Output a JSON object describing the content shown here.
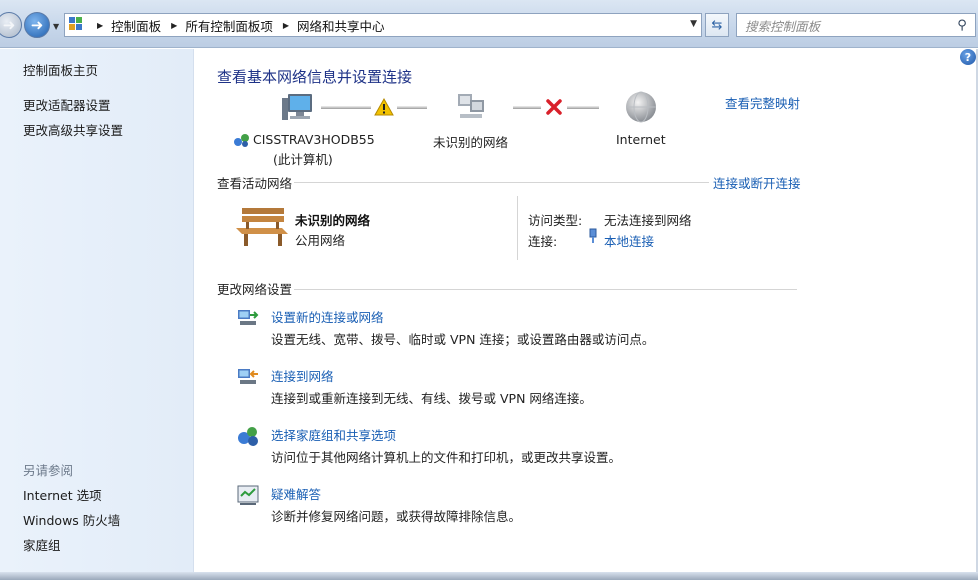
{
  "address_bar": {
    "breadcrumbs": [
      "控制面板",
      "所有控制面板项",
      "网络和共享中心"
    ],
    "search_placeholder": "搜索控制面板"
  },
  "left_pane": {
    "links": [
      "控制面板主页",
      "更改适配器设置",
      "更改高级共享设置"
    ],
    "see_also_heading": "另请参阅",
    "see_also": [
      "Internet 选项",
      "Windows 防火墙",
      "家庭组"
    ]
  },
  "main": {
    "title": "查看基本网络信息并设置连接",
    "full_map_link": "查看完整映射",
    "network_map": {
      "computer_name": "CISSTRAV3HODB55",
      "computer_sub": "(此计算机)",
      "middle_label": "未识别的网络",
      "internet_label": "Internet"
    },
    "active_networks": {
      "heading": "查看活动网络",
      "connect_link": "连接或断开连接",
      "network_name": "未识别的网络",
      "network_type": "公用网络",
      "access_type_label": "访问类型:",
      "access_type_value": "无法连接到网络",
      "connection_label": "连接:",
      "connection_value": "本地连接"
    },
    "change_settings": {
      "heading": "更改网络设置",
      "tasks": [
        {
          "title": "设置新的连接或网络",
          "desc": "设置无线、宽带、拨号、临时或 VPN 连接；或设置路由器或访问点。"
        },
        {
          "title": "连接到网络",
          "desc": "连接到或重新连接到无线、有线、拨号或 VPN 网络连接。"
        },
        {
          "title": "选择家庭组和共享选项",
          "desc": "访问位于其他网络计算机上的文件和打印机，或更改共享设置。"
        },
        {
          "title": "疑难解答",
          "desc": "诊断并修复网络问题，或获得故障排除信息。"
        }
      ]
    }
  },
  "colors": {
    "link": "#1a5fb4",
    "title": "#1e3287",
    "error_x": "#d9202a",
    "warning": "#f2c200"
  },
  "icons": [
    "back-arrow-icon",
    "forward-arrow-icon",
    "control-panel-icon",
    "refresh-icon",
    "search-icon",
    "help-icon",
    "computer-icon",
    "warning-icon",
    "network-icon",
    "error-x-icon",
    "globe-icon",
    "bench-icon",
    "ethernet-plug-icon",
    "setup-connection-icon",
    "connect-network-icon",
    "homegroup-icon",
    "troubleshoot-icon"
  ]
}
